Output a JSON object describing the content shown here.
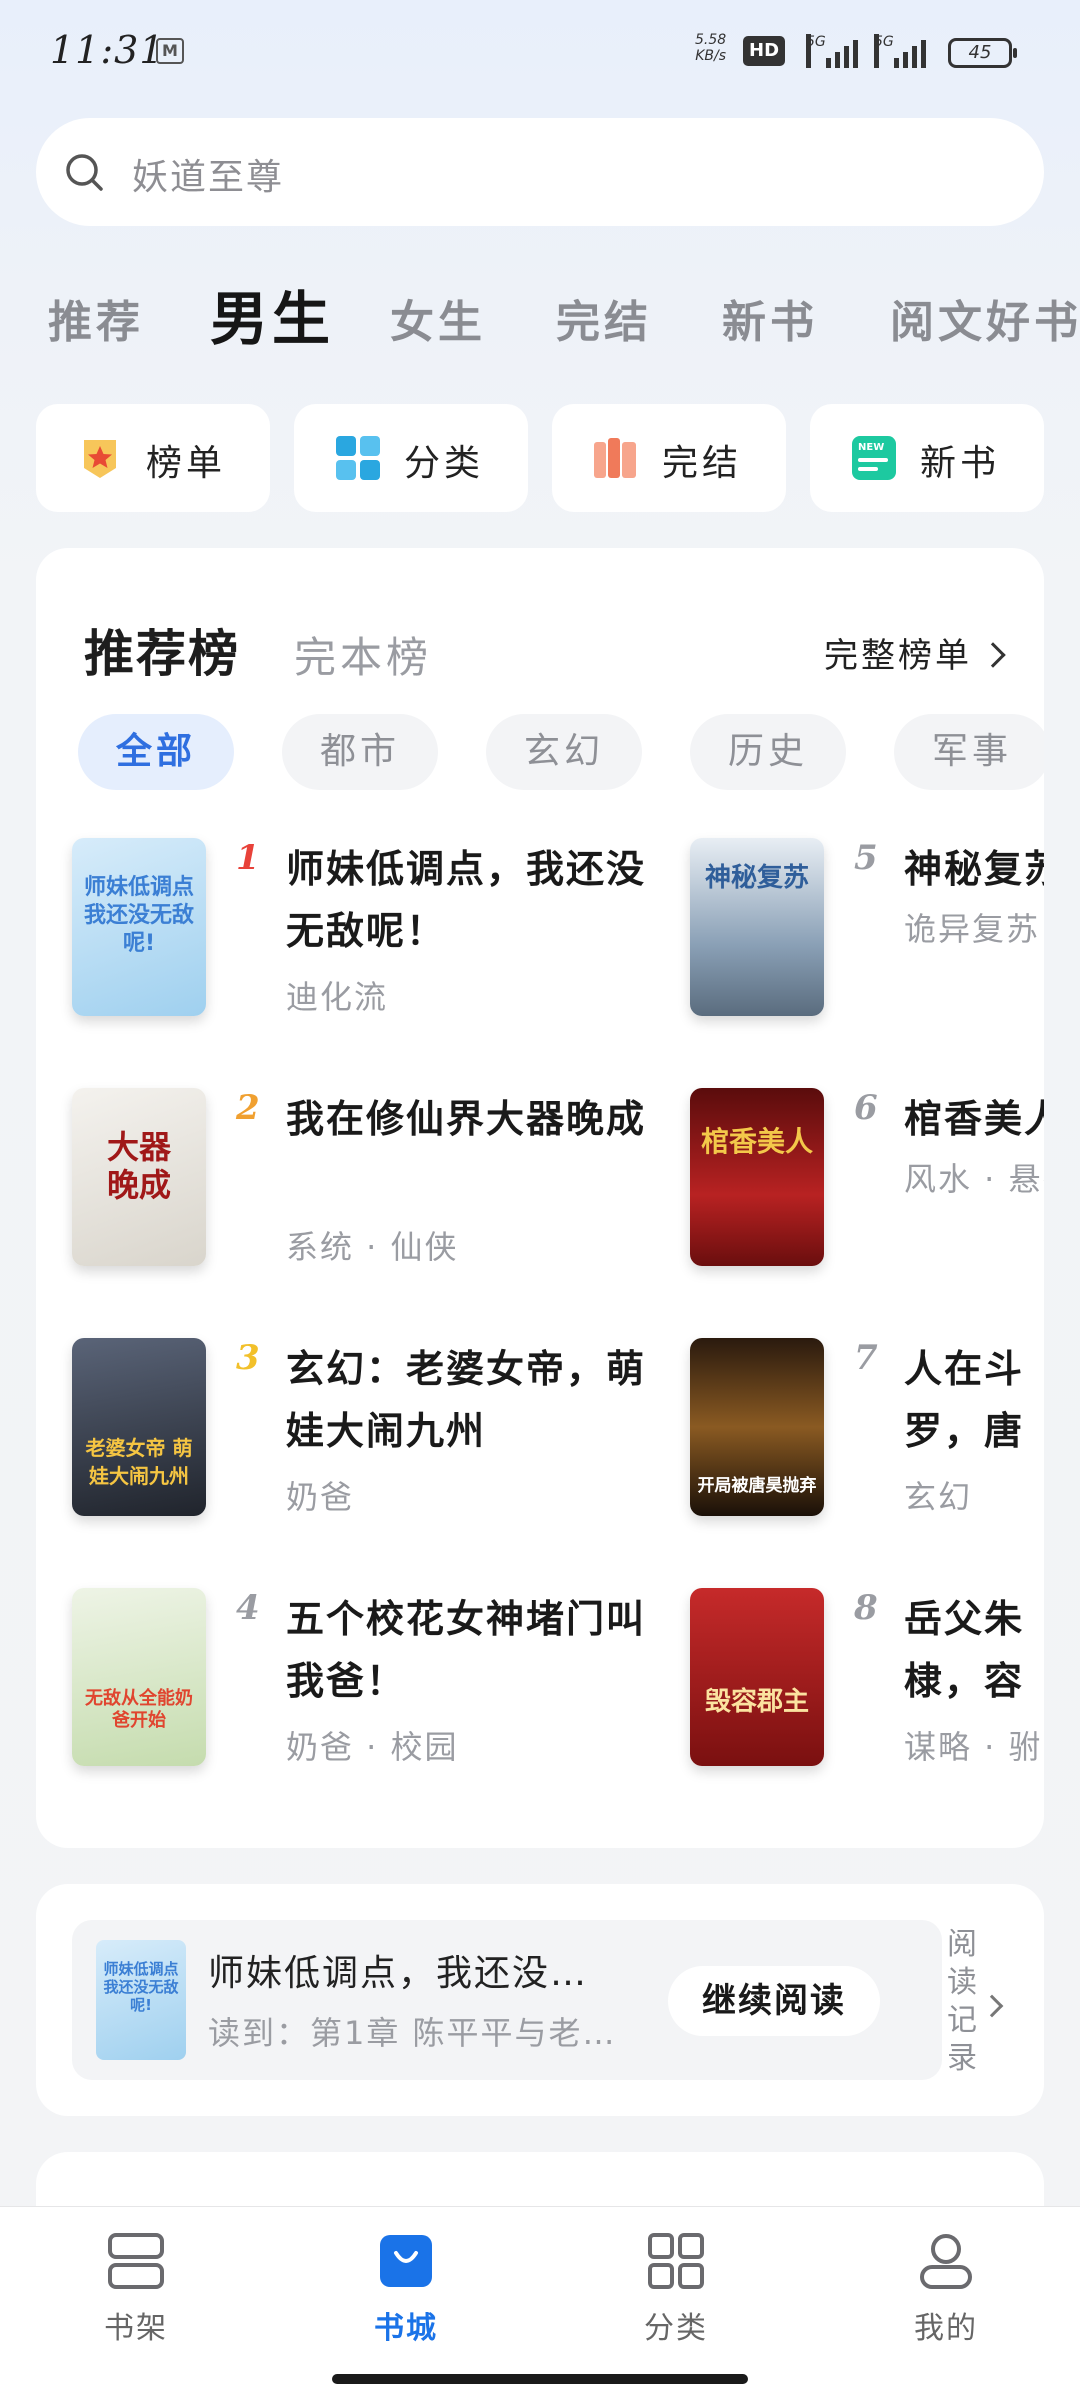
{
  "status_bar": {
    "time": "11:31",
    "mail_icon": "M",
    "net_speed": "5.58",
    "net_speed_unit": "KB/s",
    "hd_label": "HD",
    "network_1": "5G",
    "network_2": "5G",
    "battery": "45"
  },
  "search": {
    "placeholder": "妖道至尊",
    "icon": "search-icon"
  },
  "top_tabs": {
    "items": [
      "推荐",
      "男生",
      "女生",
      "完结",
      "新书",
      "阅文好书"
    ],
    "active_index": 1
  },
  "quick_entries": [
    {
      "label": "榜单",
      "icon": "rank-badge-icon",
      "color": "#f5a623"
    },
    {
      "label": "分类",
      "icon": "category-grid-icon",
      "color": "#2aa7e0"
    },
    {
      "label": "完结",
      "icon": "books-icon",
      "color": "#f07a5a"
    },
    {
      "label": "新书",
      "icon": "new-book-icon",
      "color": "#1dc9a0"
    }
  ],
  "ranking": {
    "tab_main": "推荐榜",
    "tab_second": "完本榜",
    "full_list_label": "完整榜单",
    "chips": [
      "全部",
      "都市",
      "玄幻",
      "历史",
      "军事"
    ],
    "active_chip": 0,
    "books": [
      {
        "rank": "1",
        "title": "师妹低调点，我还没无敌呢！",
        "meta": "迪化流",
        "cover_text": "师妹低调点 我还没无敌呢!",
        "rank_color": "#e8423a",
        "cover_bg": "#bfe0f5"
      },
      {
        "rank": "2",
        "title": "我在修仙界大器晚成",
        "meta": "系统 · 仙侠",
        "cover_text": "大器晚成",
        "rank_color": "#f0a030",
        "cover_bg": "#e9e6e0"
      },
      {
        "rank": "3",
        "title": "玄幻：老婆女帝，萌娃大闹九州",
        "meta": "奶爸",
        "cover_text": "老婆女帝 萌娃大闹九州",
        "rank_color": "#f2c02a",
        "cover_bg": "#2e3440"
      },
      {
        "rank": "4",
        "title": "五个校花女神堵门叫我爸！",
        "meta": "奶爸 · 校园",
        "cover_text": "无敌从全能奶爸开始",
        "rank_color": "#9a9ca2",
        "cover_bg": "#d9e7c8"
      },
      {
        "rank": "5",
        "title": "神秘复苏",
        "meta": "诡异复苏",
        "cover_text": "神秘复苏",
        "rank_color": "#9a9ca2",
        "cover_bg": "#9fb3c8"
      },
      {
        "rank": "6",
        "title": "棺香美人",
        "meta": "风水 · 悬疑",
        "cover_text": "棺香美人",
        "rank_color": "#9a9ca2",
        "cover_bg": "#8b1a1a"
      },
      {
        "rank": "7",
        "title": "人在斗罗，唐昊抛弃",
        "meta": "玄幻",
        "cover_text": "开局被唐昊抛弃",
        "rank_color": "#9a9ca2",
        "cover_bg": "#3a2a1a"
      },
      {
        "rank": "8",
        "title": "岳父朱棣，容郡主",
        "meta": "谋略 · 驸马",
        "cover_text": "毁容郡主",
        "rank_color": "#9a9ca2",
        "cover_bg": "#a31e1e"
      }
    ]
  },
  "continue_reading": {
    "title": "师妹低调点，我还没…",
    "progress": "读到：第1章 陈平平与老…",
    "button": "继续阅读",
    "history_label": "阅读记录",
    "cover_text": "师妹低调点 我还没无敌呢!"
  },
  "bottom_nav": {
    "items": [
      {
        "label": "书架",
        "icon": "bookshelf-icon"
      },
      {
        "label": "书城",
        "icon": "bookstore-bag-icon"
      },
      {
        "label": "分类",
        "icon": "category-icon"
      },
      {
        "label": "我的",
        "icon": "profile-icon"
      }
    ],
    "active_index": 1,
    "accent": "#1a73e8"
  }
}
